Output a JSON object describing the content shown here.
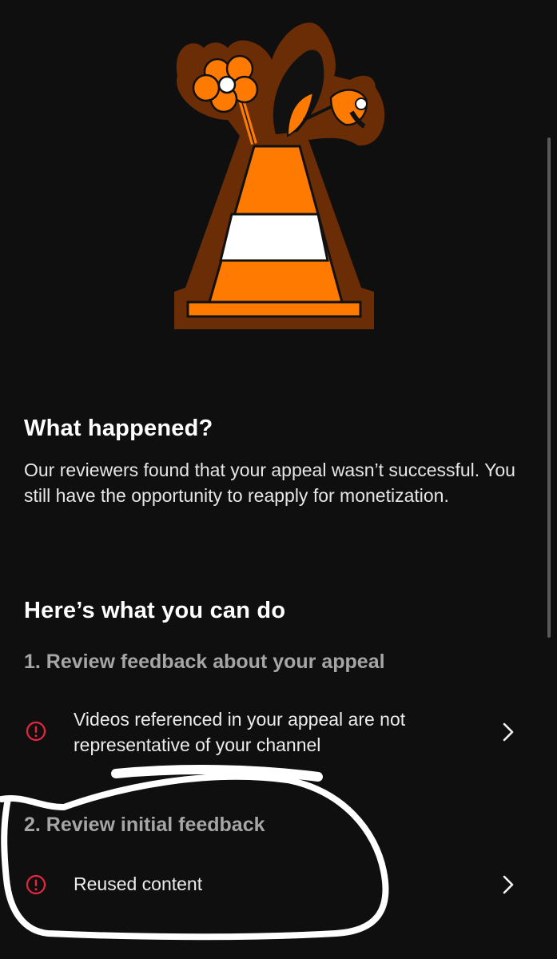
{
  "what_happened": {
    "title": "What happened?",
    "body": "Our reviewers found that your appeal wasn’t successful. You still have the opportunity to reapply for monetization."
  },
  "what_you_can_do": {
    "title": "Here’s what you can do",
    "steps": [
      {
        "title": "1. Review feedback about your appeal",
        "items": [
          {
            "text": "Videos referenced in your appeal are not representative of your channel",
            "icon": "alert-circle-icon"
          }
        ]
      },
      {
        "title": "2. Review initial feedback",
        "items": [
          {
            "text": "Reused content",
            "icon": "alert-circle-icon"
          }
        ]
      }
    ]
  },
  "colors": {
    "background": "#0f0f0f",
    "alert": "#e8263f",
    "cone_orange": "#ff7a00",
    "cone_outline": "#6b2d05"
  }
}
